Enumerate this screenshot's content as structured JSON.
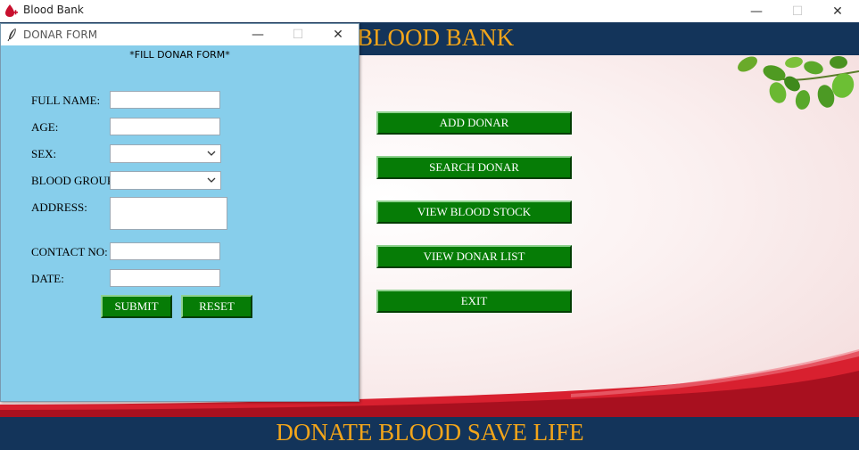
{
  "window": {
    "title": "Blood Bank",
    "minimize_glyph": "—",
    "maximize_glyph": "☐",
    "close_glyph": "✕"
  },
  "header": {
    "title": "BLOOD BANK"
  },
  "menu": {
    "buttons": [
      {
        "label": "ADD DONAR"
      },
      {
        "label": "SEARCH DONAR"
      },
      {
        "label": "VIEW BLOOD STOCK"
      },
      {
        "label": "VIEW DONAR LIST"
      },
      {
        "label": "EXIT"
      }
    ]
  },
  "footer": {
    "title": "DONATE BLOOD SAVE LIFE"
  },
  "form": {
    "window_title": "DONAR FORM",
    "heading": "*FILL DONAR FORM*",
    "labels": {
      "full_name": "FULL NAME:",
      "age": "AGE:",
      "sex": "SEX:",
      "blood_group": "BLOOD GROUP",
      "address": "ADDRESS:",
      "contact_no": "CONTACT NO:",
      "date": "DATE:"
    },
    "values": {
      "full_name": "",
      "age": "",
      "sex": "",
      "blood_group": "",
      "address": "",
      "contact_no": "",
      "date": ""
    },
    "submit_label": "SUBMIT",
    "reset_label": "RESET"
  },
  "colors": {
    "header_bg": "#13345a",
    "header_text": "#f2a51a",
    "button_bg": "#067c06",
    "form_bg": "#87ceeb",
    "wave_red": "#c8102e"
  },
  "icons": {
    "app": "blood-drop-icon",
    "form": "feather-icon"
  }
}
